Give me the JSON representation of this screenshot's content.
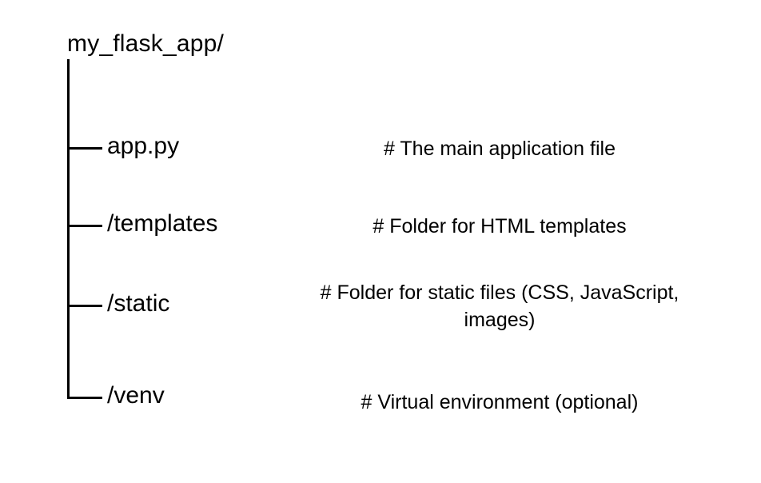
{
  "tree": {
    "root": "my_flask_app/",
    "children": [
      {
        "name": "app.py",
        "comment": "# The main application file"
      },
      {
        "name": "/templates",
        "comment": "# Folder for HTML templates"
      },
      {
        "name": "/static",
        "comment": "# Folder for static files (CSS, JavaScript, images)"
      },
      {
        "name": "/venv",
        "comment": "# Virtual environment (optional)"
      }
    ]
  }
}
